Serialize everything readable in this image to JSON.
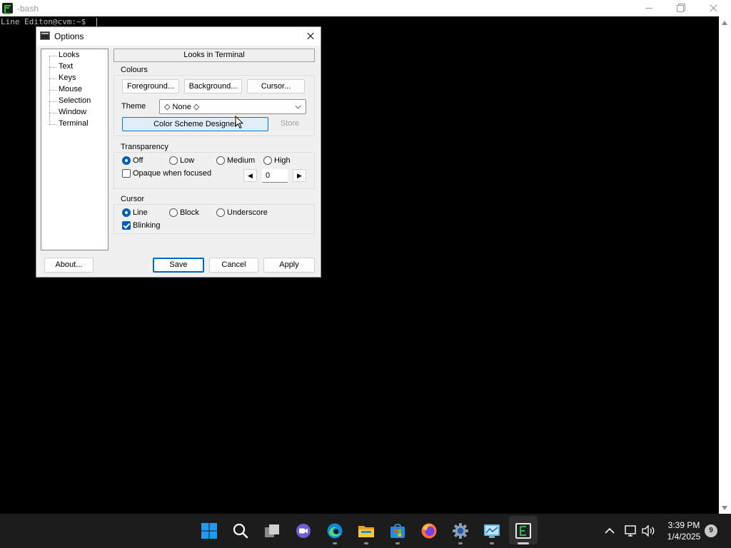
{
  "terminal": {
    "title": "-bash",
    "prompt": "Line Editon@cvm:~$"
  },
  "dialog": {
    "title": "Options",
    "nav_items": [
      "Looks",
      "Text",
      "Keys",
      "Mouse",
      "Selection",
      "Window",
      "Terminal"
    ],
    "section_header": "Looks in Terminal",
    "colours": {
      "label": "Colours",
      "foreground": "Foreground...",
      "background": "Background...",
      "cursor": "Cursor...",
      "theme_label": "Theme",
      "theme_value": "◇ None ◇",
      "designer": "Color Scheme Designer",
      "store": "Store"
    },
    "transparency": {
      "label": "Transparency",
      "options": [
        "Off",
        "Low",
        "Medium",
        "High"
      ],
      "selected": "Off",
      "opaque_label": "Opaque when focused",
      "opaque_checked": false,
      "value": "0"
    },
    "cursor": {
      "label": "Cursor",
      "options": [
        "Line",
        "Block",
        "Underscore"
      ],
      "selected": "Line",
      "blinking_label": "Blinking",
      "blinking_checked": true
    },
    "buttons": {
      "about": "About...",
      "save": "Save",
      "cancel": "Cancel",
      "apply": "Apply"
    }
  },
  "taskbar": {
    "time": "3:39 PM",
    "date": "1/4/2025",
    "notification_count": "9",
    "pinned": [
      "start-icon",
      "search-icon",
      "task-view-icon",
      "meet-icon",
      "edge-icon",
      "file-explorer-icon",
      "store-icon",
      "firefox-icon",
      "settings-icon",
      "control-panel-icon",
      "mintty-icon"
    ]
  },
  "colors": {
    "accent": "#005fb8",
    "terminal_bg": "#000000",
    "dialog_bg": "#f0f0f0",
    "taskbar_bg": "#1c1c1c"
  }
}
